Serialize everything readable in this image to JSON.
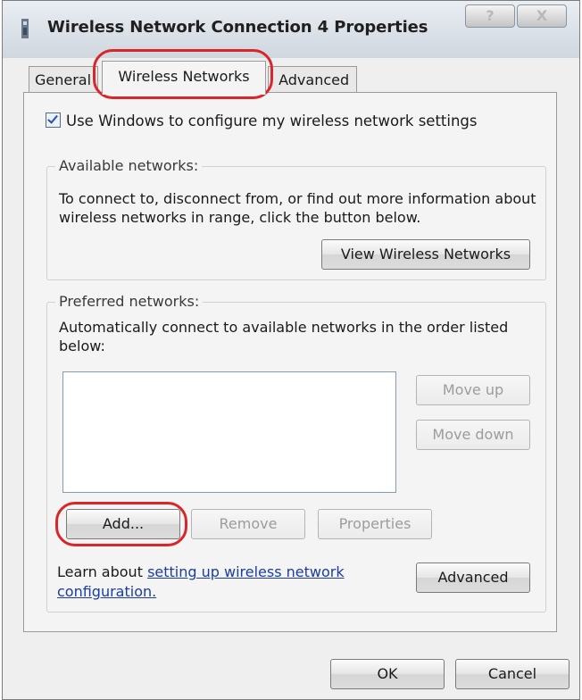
{
  "window": {
    "title": "Wireless Network Connection 4 Properties",
    "help_label": "?",
    "close_label": "X"
  },
  "tabs": [
    {
      "label": "General"
    },
    {
      "label": "Wireless Networks"
    },
    {
      "label": "Advanced"
    }
  ],
  "config": {
    "checkbox_label": "Use Windows to configure my wireless network settings",
    "checked": true
  },
  "available": {
    "legend": "Available networks:",
    "text": "To connect to, disconnect from, or find out more information about wireless networks in range, click the button below.",
    "view_button": "View Wireless Networks"
  },
  "preferred": {
    "legend": "Preferred networks:",
    "text": "Automatically connect to available networks in the order listed below:",
    "move_up": "Move up",
    "move_down": "Move down",
    "add": "Add...",
    "remove": "Remove",
    "properties": "Properties"
  },
  "learn": {
    "prefix": "Learn about ",
    "link": "setting up wireless network configuration."
  },
  "buttons": {
    "advanced": "Advanced",
    "ok": "OK",
    "cancel": "Cancel"
  },
  "colors": {
    "highlight_ring": "#d9262b",
    "link": "#1a3e9e"
  }
}
